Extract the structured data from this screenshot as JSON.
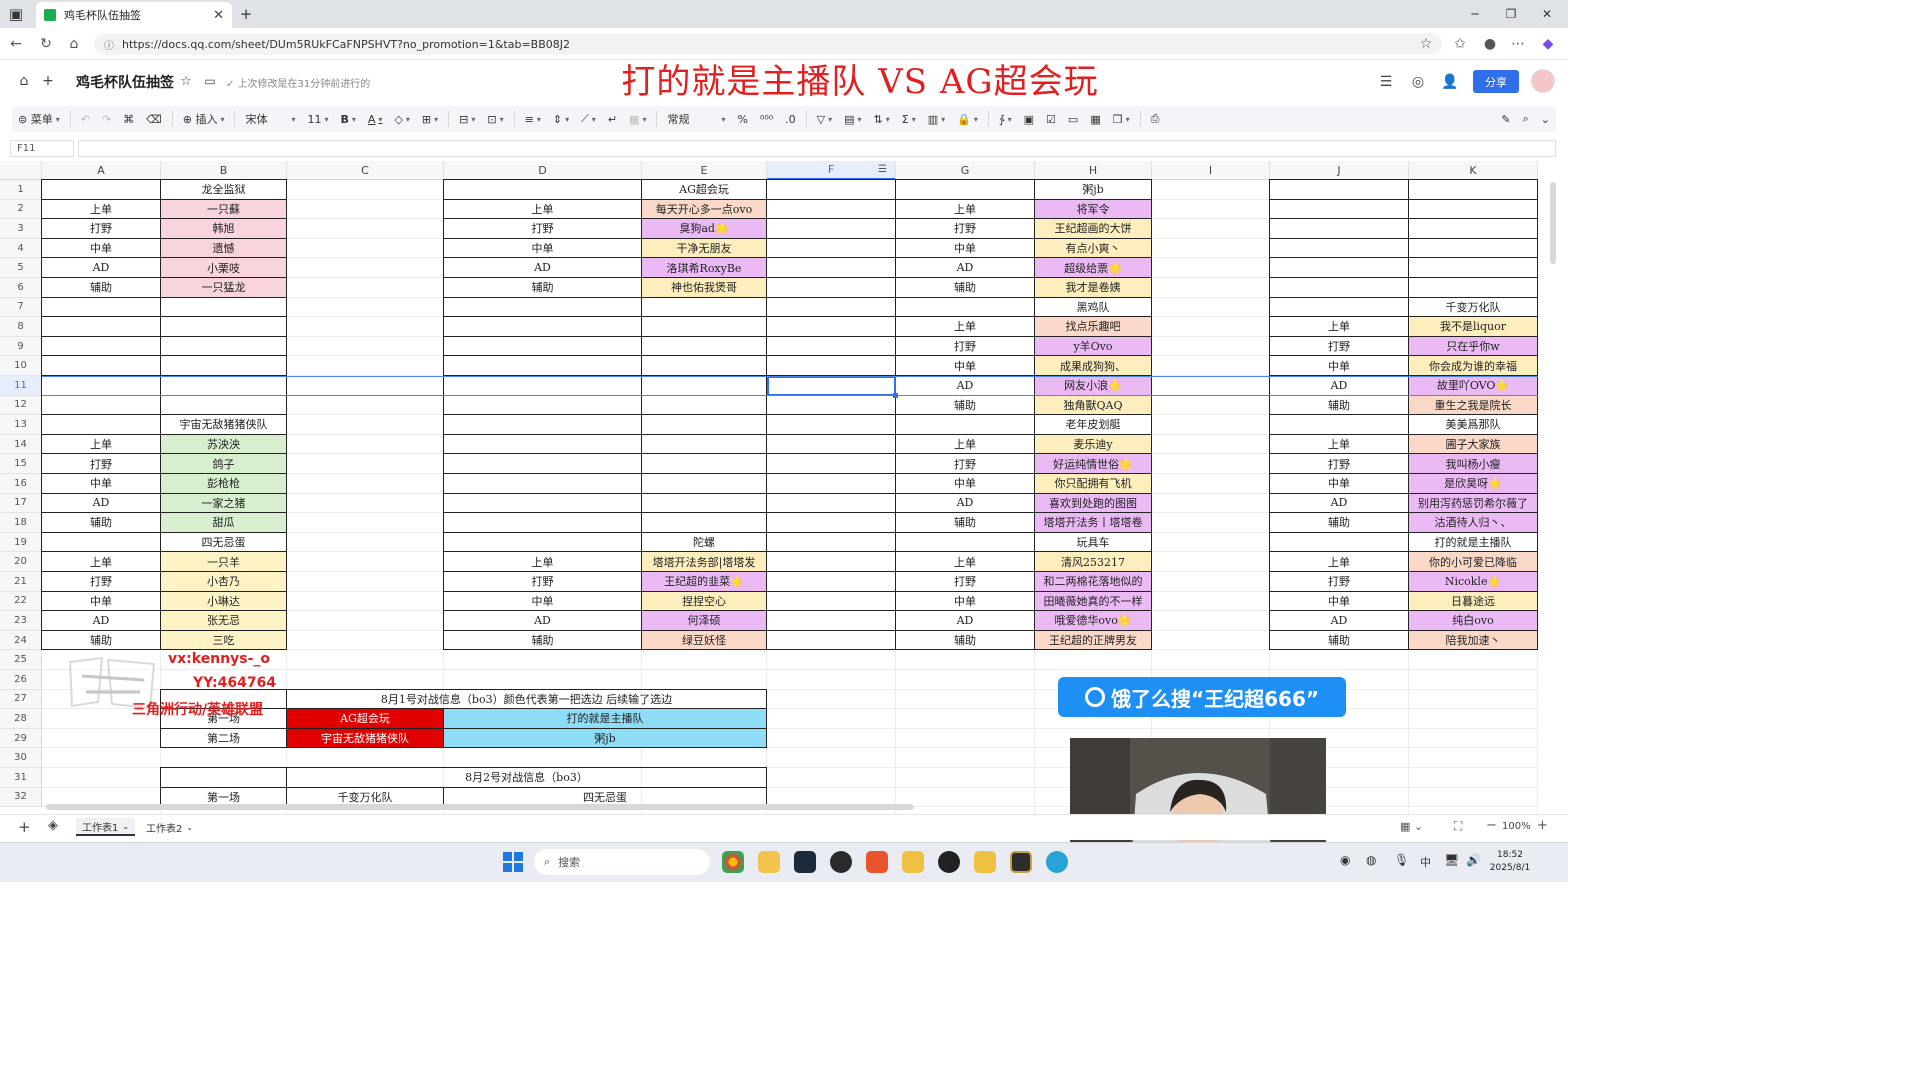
{
  "browser": {
    "tab_title": "鸡毛杯队伍抽签",
    "url": "https://docs.qq.com/sheet/DUm5RUkFCaFNPSHVT?no_promotion=1&tab=BB08J2"
  },
  "doc": {
    "title": "鸡毛杯队伍抽签",
    "save_status": "上次修改是在31分钟前进行的",
    "share_label": "分享"
  },
  "overlay_title": "打的就是主播队 VS AG超会玩",
  "toolbar": {
    "menu": "菜单",
    "insert": "插入",
    "font": "宋体",
    "font_size": "11",
    "bold": "B",
    "font_color": "A",
    "number_format": "常规",
    "percent": "%",
    "thousands": "⁰⁰⁰",
    "decimal": ".0"
  },
  "formula_bar": {
    "cell_ref": "F11",
    "content": ""
  },
  "columns": [
    "A",
    "B",
    "C",
    "D",
    "E",
    "F",
    "G",
    "H",
    "I",
    "J",
    "K"
  ],
  "selected_column": "F",
  "selected_row": 11,
  "rows": [
    "1",
    "2",
    "3",
    "4",
    "5",
    "6",
    "7",
    "8",
    "9",
    "10",
    "11",
    "12",
    "13",
    "14",
    "15",
    "16",
    "17",
    "18",
    "19",
    "20",
    "21",
    "22",
    "23",
    "24",
    "25",
    "26",
    "27",
    "28",
    "29",
    "30",
    "31",
    "32"
  ],
  "roles": [
    "上单",
    "打野",
    "中单",
    "AD",
    "辅助"
  ],
  "teams": [
    {
      "name": "龙全监狱",
      "players": [
        "一只蘇",
        "韩旭",
        "遗憾",
        "小栗吱",
        "一只猛龙"
      ]
    },
    {
      "name": "AG超会玩",
      "players": [
        "每天开心多一点ovo",
        "臭狗ad🌟",
        "干净无朋友",
        "洛琪希RoxyBe",
        "神也佑我煲哥"
      ]
    },
    {
      "name": "粥jb",
      "players": [
        "将军令",
        "王纪超画的大饼",
        "有点小爽丶",
        "超级给票🌟",
        "我才是卷姨"
      ]
    },
    {
      "name": "黑鸡队",
      "players": [
        "找点乐趣吧",
        "y羊Ovo",
        "成果成狗狗、",
        "网友小浪🌟",
        "独角獸QAQ"
      ]
    },
    {
      "name": "千变万化队",
      "players": [
        "我不是liquor",
        "只在乎你w",
        "你会成为谁的幸福",
        "故里吖OVO🌟",
        "重生之我是院长"
      ]
    },
    {
      "name": "宇宙无敌猪猪侠队",
      "players": [
        "苏泱泱",
        "鸽子",
        "彭枪枪",
        "一家之猪",
        "甜瓜"
      ]
    },
    {
      "name": "老年皮划艇",
      "players": [
        "麦乐迪y",
        "好运纯情世俗🌟",
        "你只配拥有飞机",
        "喜欢到处跑的图图",
        "塔塔开法务丨塔塔卷"
      ]
    },
    {
      "name": "美美爲那队",
      "players": [
        "圃子大家族",
        "我叫杨小瘦",
        "是欣昊呀🌟",
        "别用泻药惩罚希尔薇了",
        "沽酒待人归丶、"
      ]
    },
    {
      "name": "四无忌蛋",
      "players": [
        "一只羊",
        "小杏乃",
        "小琳达",
        "张无忌",
        "三吃"
      ]
    },
    {
      "name": "陀螺",
      "players": [
        "塔塔开法务部|塔塔发",
        "王纪超的韭菜🌟",
        "捏捏空心",
        "何泽硕",
        "绿豆妖怪"
      ]
    },
    {
      "name": "玩具车",
      "players": [
        "清风253217",
        "和二两棉花落地似的",
        "田曦薇她真的不一样",
        "哦爱德华ovo🌟",
        "王纪超的正牌男友"
      ]
    },
    {
      "name": "打的就是主播队",
      "players": [
        "你的小可爱已降临",
        "Nicokle🌟",
        "日暮途远",
        "纯白ovo",
        "陪我加速丶"
      ]
    }
  ],
  "schedule": {
    "day1_title": "8月1号对战信息（bo3）颜色代表第一把选边 后续输了选边",
    "day1_round1": "第一场",
    "day1_round1_team_a": "AG超会玩",
    "day1_round1_team_b": "打的就是主播队",
    "day1_round2": "第二场",
    "day1_round2_team_a": "宇宙无敌猪猪侠队",
    "day1_round2_team_b": "粥jb",
    "day2_title": "8月2号对战信息（bo3）",
    "day2_round1": "第一场",
    "day2_round1_team_a": "千变万化队",
    "day2_round1_team_b": "四无忌蛋"
  },
  "watermark": {
    "line1": "vx:kennys-_o",
    "line2": "YY:464764",
    "line3": "三角洲行动/英雄联盟"
  },
  "banner": "饿了么搜“王纪超666”",
  "sheets": [
    "工作表1",
    "工作表2"
  ],
  "zoom": "100%",
  "taskbar": {
    "search_placeholder": "搜索",
    "ime": "中",
    "time": "18:52",
    "date": "2025/8/1"
  },
  "colors": {
    "pink": "#f8d5dc",
    "violet": "#ebbaf5",
    "yellow": "#fcefbd",
    "peach": "#fbd9c8",
    "green": "#d8efcf",
    "light_yellow": "#fdf3c4",
    "red_cell": "#e10000",
    "cyan_cell": "#8fdcf6",
    "accent": "#2f6fec",
    "title_red": "#e21f1f"
  }
}
